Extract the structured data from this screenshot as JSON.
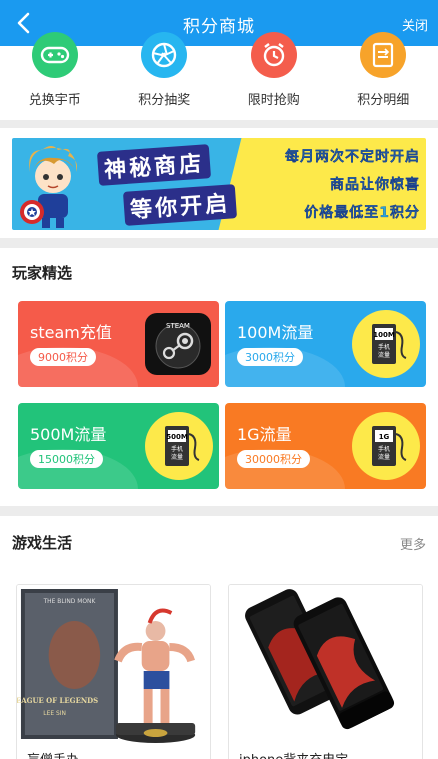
{
  "header": {
    "title": "积分商城",
    "close_label": "关闭"
  },
  "quicknav": [
    {
      "label": "兑换宇币",
      "icon": "gamepad-icon",
      "color": "#2ecb77"
    },
    {
      "label": "积分抽奖",
      "icon": "aperture-icon",
      "color": "#27b6f0"
    },
    {
      "label": "限时抢购",
      "icon": "alarm-clock-icon",
      "color": "#f45d4c"
    },
    {
      "label": "积分明细",
      "icon": "receipt-icon",
      "color": "#f7a32a"
    }
  ],
  "banner": {
    "line_a": "神秘商店",
    "line_b": "等你开启",
    "right_1": "每月两次不定时开启",
    "right_2": "商品让你惊喜",
    "right_3": "价格最低至1积分"
  },
  "picks": {
    "title": "玩家精选",
    "cards": [
      {
        "name": "steam充值",
        "price": "9000积分",
        "deco": "steam-logo-icon",
        "deco_text": "STEAM"
      },
      {
        "name": "100M流量",
        "price": "3000积分",
        "deco": "phone-data-icon",
        "deco_text": "100M",
        "deco_sub": "手机\n流量"
      },
      {
        "name": "500M流量",
        "price": "15000积分",
        "deco": "phone-data-icon",
        "deco_text": "500M",
        "deco_sub": "手机\n流量"
      },
      {
        "name": "1G流量",
        "price": "30000积分",
        "deco": "phone-data-icon",
        "deco_text": "1G",
        "deco_sub": "手机\n流量"
      }
    ]
  },
  "games": {
    "title": "游戏生活",
    "more_label": "更多",
    "products": [
      {
        "name": "盲僧手办",
        "box_text": "THE BLIND MONK",
        "box_logo": "LEAGUE OF LEGENDS",
        "box_sub": "LEE SIN"
      },
      {
        "name": "iphone背夹充电宝"
      }
    ]
  }
}
